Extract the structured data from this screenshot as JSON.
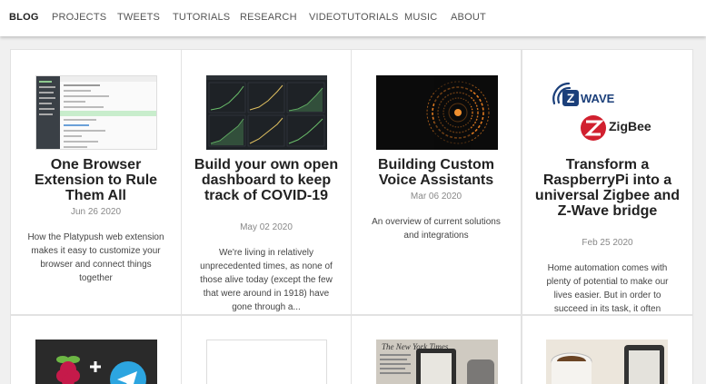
{
  "nav": {
    "items": [
      "BLOG",
      "PROJECTS",
      "TWEETS",
      "TUTORIALS",
      "RESEARCH",
      "VIDEOTUTORIALS",
      "MUSIC",
      "ABOUT"
    ],
    "active": "BLOG"
  },
  "posts": [
    {
      "title": "One Browser Extension to Rule Them All",
      "date": "Jun 26 2020",
      "description": "How the Platypush web extension makes it easy to customize your browser and connect things together"
    },
    {
      "title": "Build your own open dashboard to keep track of COVID-19",
      "date": "May 02 2020",
      "description": "We're living in relatively unprecedented times, as none of those alive today (except the few that were around in 1918) have gone through a..."
    },
    {
      "title": "Building Custom Voice Assistants",
      "date": "Mar 06 2020",
      "description": "An overview of current solutions and integrations"
    },
    {
      "title": "Transform a RaspberryPi into a universal Zigbee and Z-Wave bridge",
      "date": "Feb 25 2020",
      "description": "Home automation comes with plenty of potential to make our lives easier. But in order to succeed in its task, it often"
    }
  ],
  "logos": {
    "zwave": "WAVE",
    "zigbee": "ZigBee",
    "newspaper": "The New York Times"
  },
  "colors": {
    "accent_green": "#4caf50",
    "orange": "#e07a1f",
    "telegram": "#2ca5e0",
    "raspberry": "#c51a4a",
    "zwave_blue": "#1b3f7a",
    "zigbee_red": "#d1202f"
  }
}
